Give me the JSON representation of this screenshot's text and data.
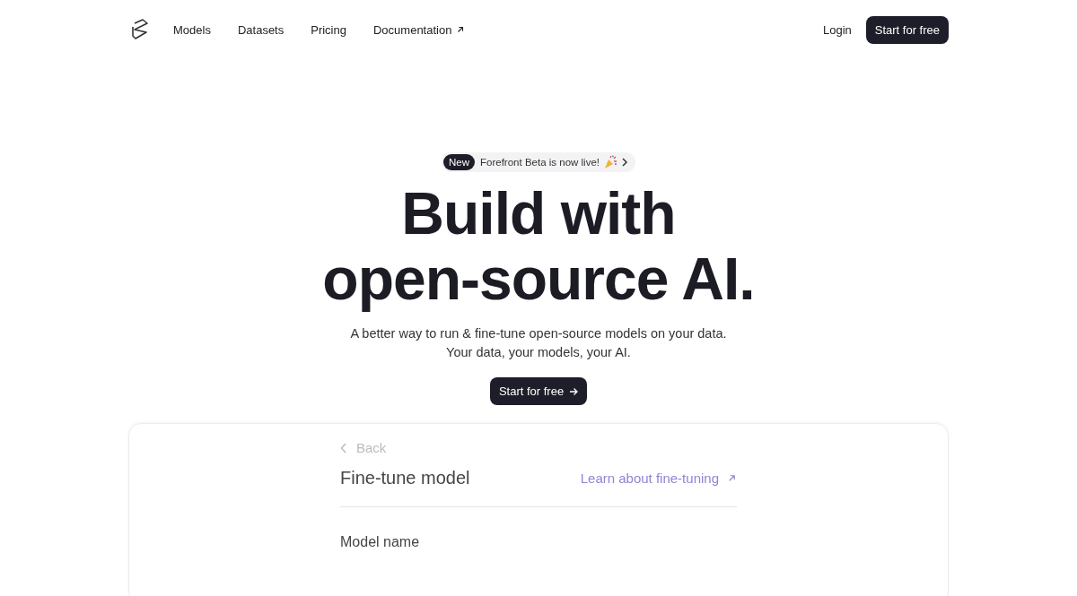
{
  "nav": {
    "links": [
      {
        "label": "Models",
        "external": false
      },
      {
        "label": "Datasets",
        "external": false
      },
      {
        "label": "Pricing",
        "external": false
      },
      {
        "label": "Documentation",
        "external": true
      }
    ],
    "login": "Login",
    "cta": "Start for free"
  },
  "hero": {
    "announcement": {
      "badge": "New",
      "text": "Forefront Beta is now live!"
    },
    "title_lines": [
      "Build with",
      "open-source AI."
    ],
    "subtitle_lines": [
      "A better way to run & fine-tune open-source models on your data.",
      "Your data, your models, your AI."
    ],
    "cta": "Start for free"
  },
  "preview": {
    "back": "Back",
    "title": "Fine-tune model",
    "link": "Learn about fine-tuning",
    "field_label": "Model name"
  }
}
